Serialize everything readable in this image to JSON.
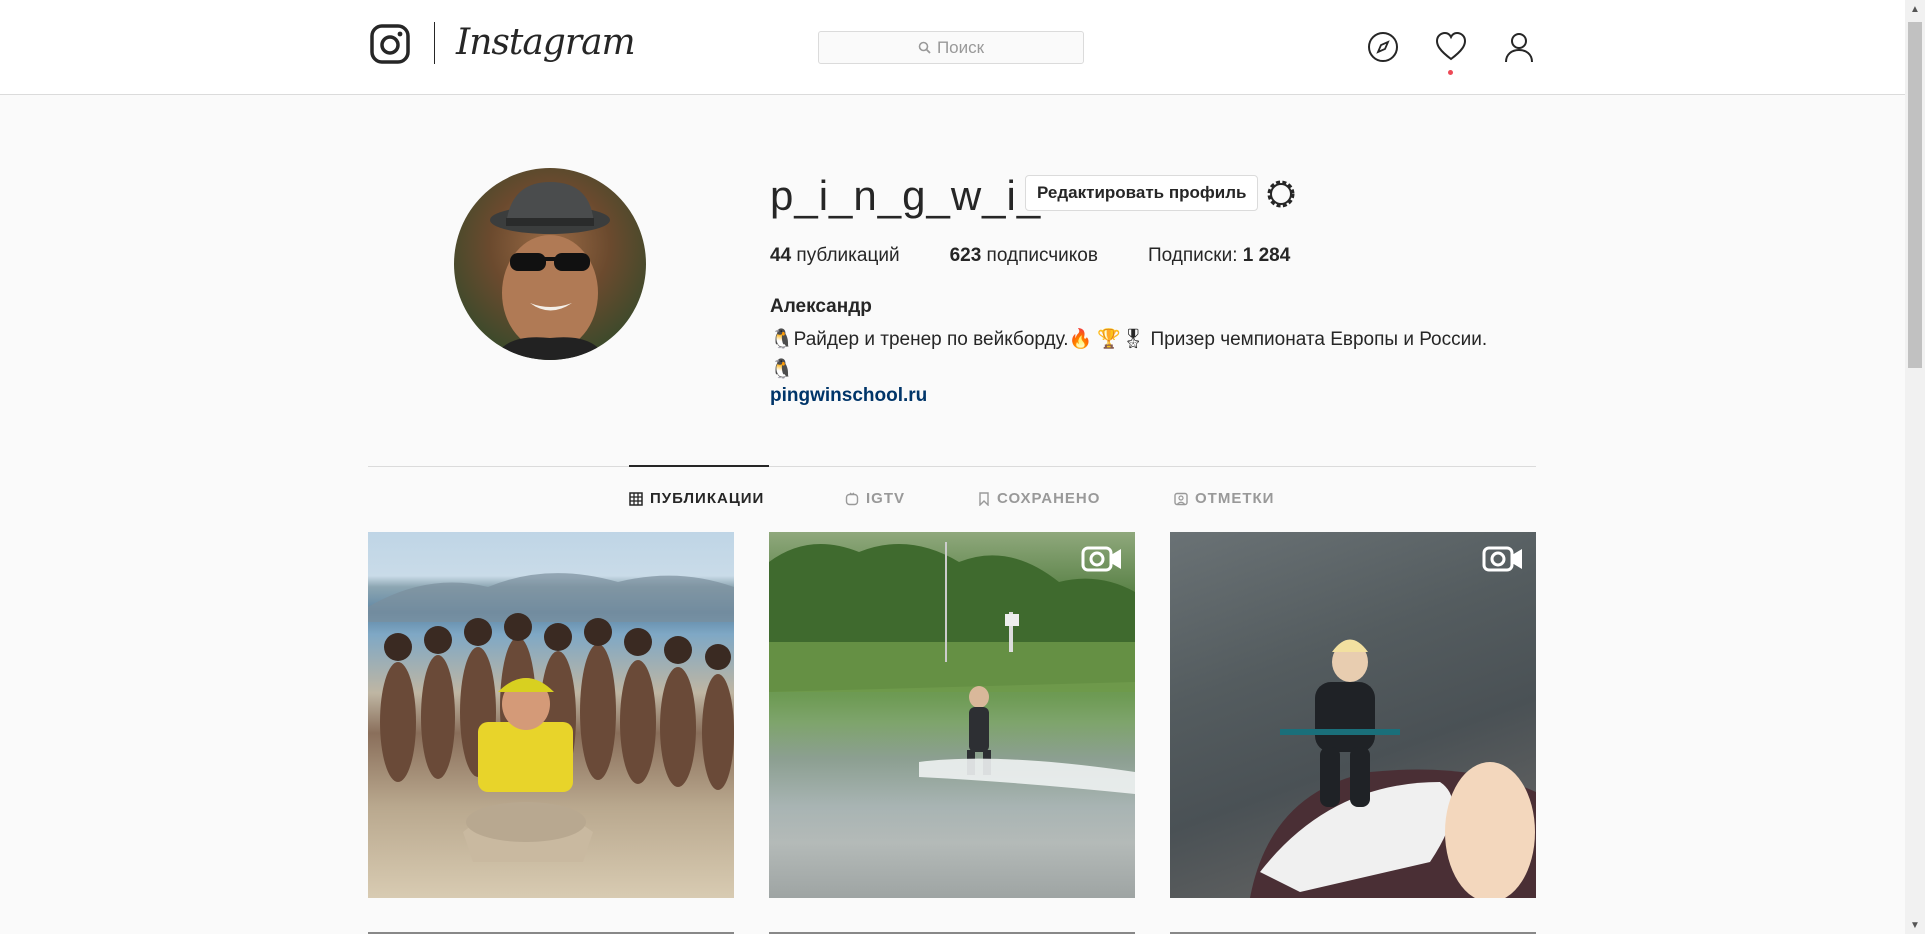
{
  "header": {
    "logo_text": "Instagram",
    "search": {
      "placeholder": "Поиск"
    },
    "icons": [
      "compass-icon",
      "heart-icon",
      "profile-icon"
    ]
  },
  "profile": {
    "username": "p_i_n_g_w_i_n",
    "edit_button": "Редактировать профиль",
    "stats": {
      "posts_count": "44",
      "posts_label": "публикаций",
      "followers_count": "623",
      "followers_label": "подписчиков",
      "following_label": "Подписки:",
      "following_count": "1 284"
    },
    "full_name": "Александр",
    "bio_line1": "🐧Райдер и тренер по вейкборду.🔥 🏆🎖 Призер чемпионата Европы и России.",
    "bio_line2": "🐧",
    "website": "pingwinschool.ru"
  },
  "tabs": [
    {
      "label": "ПУБЛИКАЦИИ",
      "icon": "grid-icon",
      "active": true
    },
    {
      "label": "IGTV",
      "icon": "igtv-icon",
      "active": false
    },
    {
      "label": "СОХРАНЕНО",
      "icon": "bookmark-icon",
      "active": false
    },
    {
      "label": "ОТМЕТКИ",
      "icon": "tagged-icon",
      "active": false
    }
  ],
  "posts": [
    {
      "type": "photo"
    },
    {
      "type": "video"
    },
    {
      "type": "video"
    }
  ],
  "colors": {
    "link": "#003569",
    "border": "#dbdbdb",
    "notification": "#ed4956"
  }
}
